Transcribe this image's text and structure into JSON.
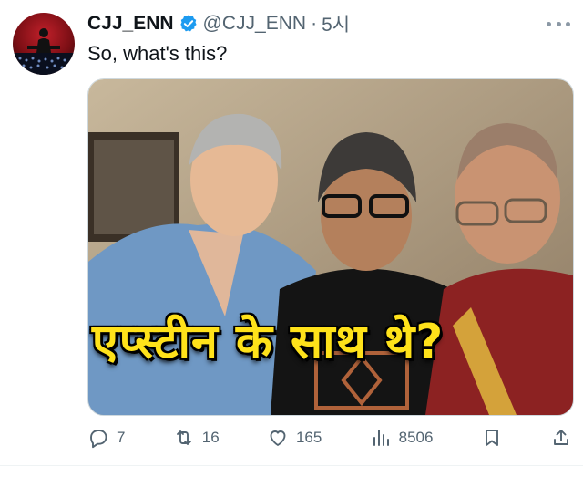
{
  "author": {
    "display_name": "CJJ_ENN",
    "handle": "@CJJ_ENN",
    "separator": "·",
    "time": "5시",
    "verified": true,
    "verified_color": "#1d9bf0"
  },
  "tweet": {
    "text": "So, what's this?"
  },
  "media": {
    "caption": "एप्स्टीन के साथ थे?",
    "caption_color": "#ffe21a"
  },
  "actions": {
    "replies": "7",
    "retweets": "16",
    "likes": "165",
    "views": "8506"
  },
  "icons": [
    "more-icon",
    "verified-icon",
    "reply-icon",
    "retweet-icon",
    "like-icon",
    "views-icon",
    "bookmark-icon",
    "share-icon"
  ]
}
